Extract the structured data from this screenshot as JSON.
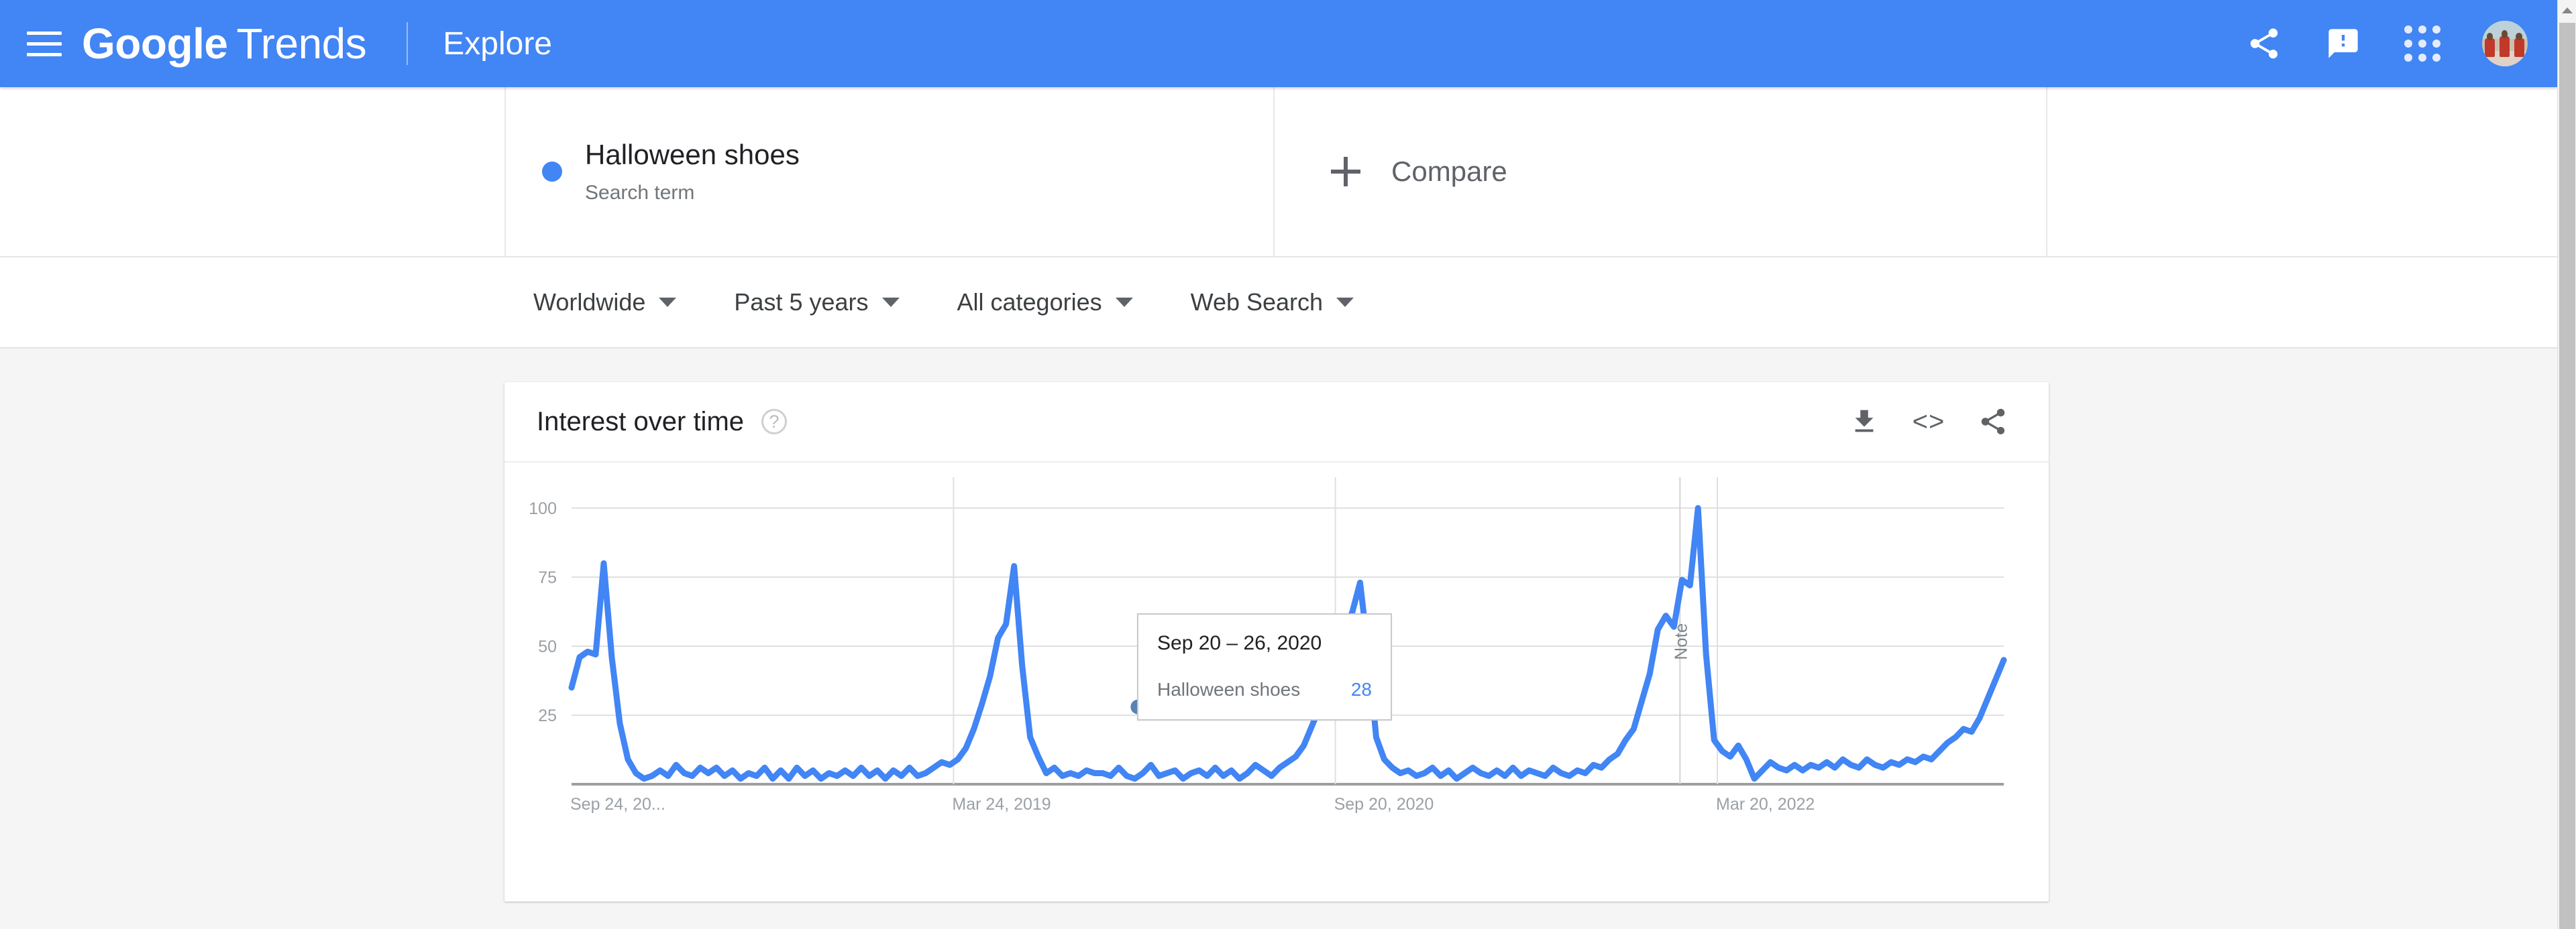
{
  "appbar": {
    "menu_icon": "hamburger-menu-icon",
    "brand_bold": "Google",
    "brand_light": "Trends",
    "section": "Explore",
    "share_icon": "share-icon",
    "feedback_icon": "feedback-icon",
    "apps_icon": "google-apps-icon",
    "avatar": "user-avatar",
    "bg_color": "#4285f4"
  },
  "search_term": {
    "term": "Halloween shoes",
    "type": "Search term",
    "dot_color": "#4285f4",
    "compare_label": "Compare"
  },
  "filters": [
    {
      "label": "Worldwide"
    },
    {
      "label": "Past 5 years"
    },
    {
      "label": "All categories"
    },
    {
      "label": "Web Search"
    }
  ],
  "card": {
    "title": "Interest over time",
    "help_icon": "?",
    "download_icon": "download-icon",
    "embed_icon": "<>",
    "share_icon": "share-icon"
  },
  "tooltip": {
    "date": "Sep 20 – 26, 2020",
    "term": "Halloween shoes",
    "value": "28"
  },
  "chart_data": {
    "type": "line",
    "title": "Interest over time",
    "xlabel": "",
    "ylabel": "",
    "ylim": [
      0,
      100
    ],
    "y_ticks": [
      "100",
      "75",
      "50",
      "25"
    ],
    "y_tick_values": [
      100,
      75,
      50,
      25
    ],
    "x_ticks": [
      "Sep 24, 20...",
      "Mar 24, 2019",
      "Sep 20, 2020",
      "Mar 20, 2022"
    ],
    "x_tick_positions": [
      0,
      0.2667,
      0.5333,
      0.8
    ],
    "grid": true,
    "legend": "none",
    "line_color": "#4285f4",
    "annotations": [
      {
        "text": "Note",
        "x_frac": 0.7739,
        "orientation": "vertical"
      }
    ],
    "highlight_point": {
      "label": "Sep 20 – 26, 2020",
      "value": 28,
      "x_frac": 0.3955
    },
    "series": [
      {
        "name": "Halloween shoes",
        "values": [
          35,
          46,
          48,
          47,
          80,
          46,
          22,
          9,
          4,
          2,
          3,
          5,
          3,
          7,
          4,
          3,
          6,
          4,
          6,
          3,
          5,
          2,
          4,
          3,
          6,
          2,
          5,
          2,
          6,
          3,
          5,
          2,
          4,
          3,
          5,
          3,
          6,
          3,
          5,
          2,
          5,
          3,
          6,
          3,
          4,
          6,
          8,
          7,
          9,
          13,
          20,
          29,
          39,
          53,
          58,
          79,
          43,
          17,
          10,
          4,
          6,
          3,
          4,
          3,
          5,
          4,
          4,
          3,
          6,
          3,
          2,
          4,
          7,
          3,
          4,
          5,
          2,
          4,
          5,
          3,
          6,
          3,
          5,
          2,
          4,
          7,
          5,
          3,
          6,
          8,
          10,
          14,
          21,
          28,
          36,
          51,
          57,
          62,
          73,
          48,
          17,
          9,
          6,
          4,
          5,
          3,
          4,
          6,
          3,
          5,
          2,
          4,
          6,
          4,
          3,
          5,
          3,
          6,
          3,
          5,
          4,
          3,
          6,
          4,
          3,
          5,
          4,
          7,
          6,
          9,
          11,
          16,
          20,
          30,
          40,
          56,
          61,
          57,
          74,
          72,
          100,
          47,
          16,
          12,
          10,
          14,
          9,
          2,
          5,
          8,
          6,
          5,
          7,
          5,
          7,
          6,
          8,
          6,
          9,
          7,
          6,
          9,
          7,
          6,
          8,
          7,
          9,
          8,
          10,
          9,
          12,
          15,
          17,
          20,
          19,
          24,
          31,
          38,
          45
        ]
      }
    ]
  }
}
